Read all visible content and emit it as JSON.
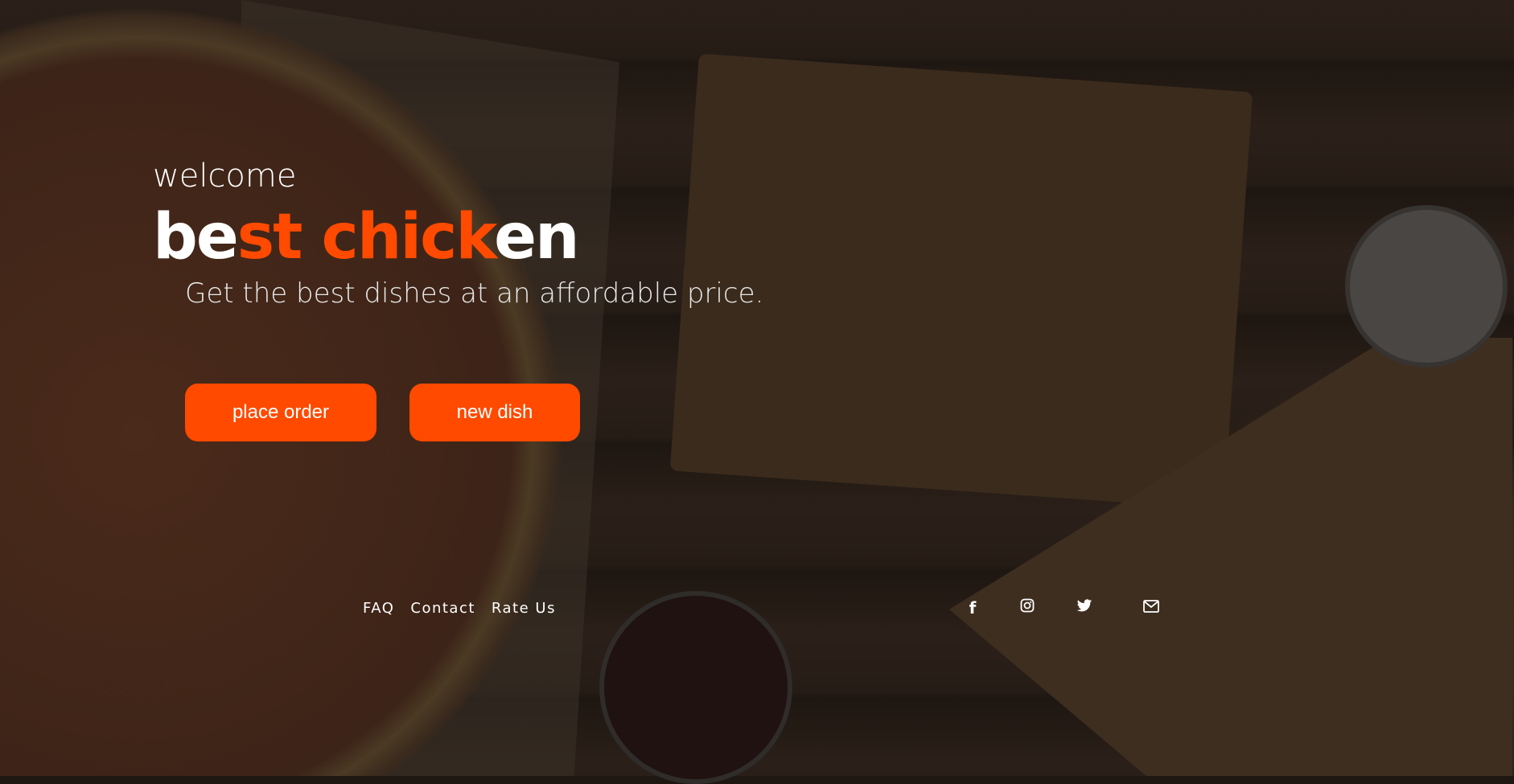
{
  "hero": {
    "welcome": "welcome",
    "title_parts": [
      "be",
      "st chick",
      "en"
    ],
    "subtitle": "Get the best dishes at an affordable price.",
    "buttons": {
      "place_order": "place order",
      "new_dish": "new dish"
    }
  },
  "footer": {
    "links": [
      "FAQ",
      "Contact",
      "Rate Us"
    ],
    "social_icons": [
      "facebook-icon",
      "instagram-icon",
      "twitter-icon",
      "mail-icon"
    ]
  },
  "colors": {
    "accent": "#ff4a00",
    "text": "#ffffff"
  }
}
